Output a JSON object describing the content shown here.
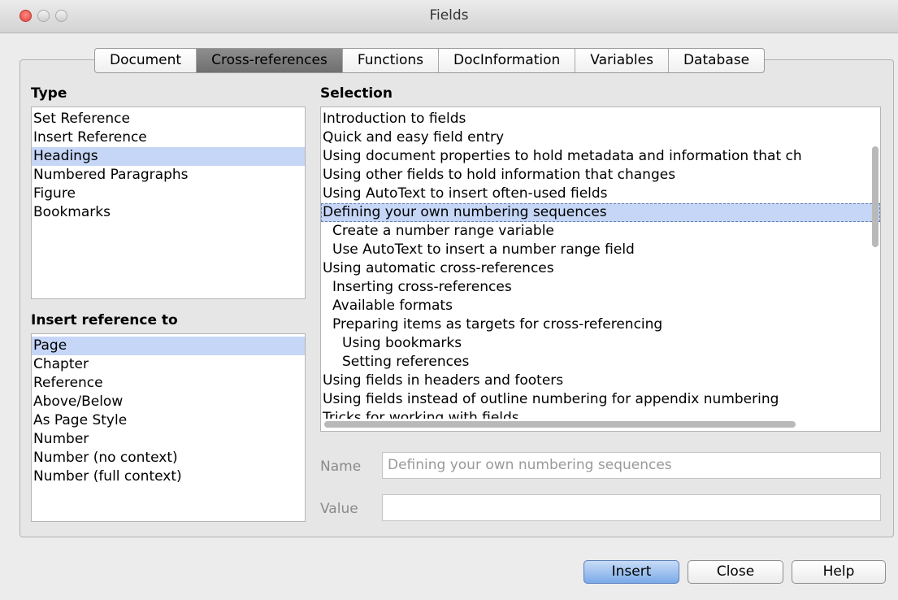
{
  "window": {
    "title": "Fields"
  },
  "tabs": [
    "Document",
    "Cross-references",
    "Functions",
    "DocInformation",
    "Variables",
    "Database"
  ],
  "active_tab": "Cross-references",
  "type": {
    "label": "Type",
    "items": [
      "Set Reference",
      "Insert Reference",
      "Headings",
      "Numbered Paragraphs",
      "Figure",
      "Bookmarks"
    ],
    "selected": "Headings"
  },
  "insert_reference": {
    "label": "Insert reference to",
    "items": [
      "Page",
      "Chapter",
      "Reference",
      "Above/Below",
      "As Page Style",
      "Number",
      "Number (no context)",
      "Number (full context)"
    ],
    "selected": "Page"
  },
  "selection": {
    "label": "Selection",
    "items": [
      "Introduction to fields",
      "Quick and easy field entry",
      "Using document properties to hold metadata and information that ch",
      "Using other fields to hold information that changes",
      "Using AutoText to insert often-used fields",
      "Defining your own numbering sequences",
      "Create a number range variable",
      "Use AutoText to insert a number range field",
      "Using automatic cross-references",
      "Inserting cross-references",
      "Available formats",
      "Preparing items as targets for cross-referencing",
      "Using bookmarks",
      "Setting references",
      "Using fields in headers and footers",
      "Using fields instead of outline numbering for appendix numbering",
      "Tricks for working with fields"
    ],
    "selected": "Defining your own numbering sequences"
  },
  "name": {
    "label": "Name",
    "value": "Defining your own numbering sequences"
  },
  "value": {
    "label": "Value",
    "value": ""
  },
  "buttons": {
    "insert": "Insert",
    "close": "Close",
    "help": "Help"
  }
}
